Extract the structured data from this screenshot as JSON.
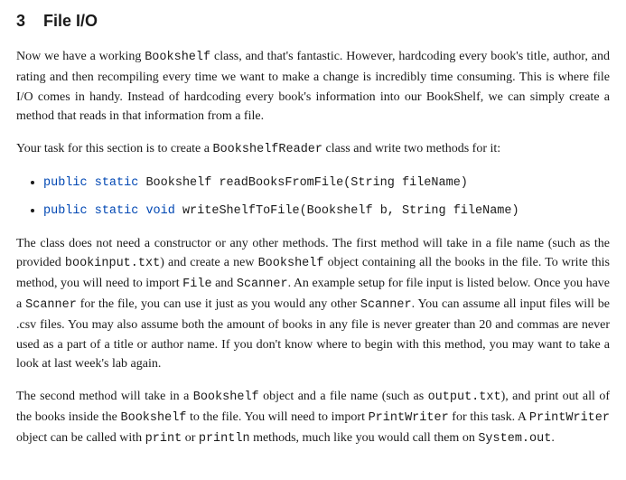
{
  "heading": {
    "number": "3",
    "title": "File I/O"
  },
  "para1": {
    "t1": "Now we have a working ",
    "c1": "Bookshelf",
    "t2": " class, and that's fantastic. However, hardcoding every book's title, author, and rating and then recompiling every time we want to make a change is incredibly time consuming. This is where file I/O comes in handy. Instead of hardcoding every book's information into our BookShelf, we can simply create a method that reads in that information from a file."
  },
  "para2": {
    "t1": "Your task for this section is to create a ",
    "c1": "BookshelfReader",
    "t2": " class and write two methods for it:"
  },
  "sig1": {
    "kw1": "public",
    "kw2": "static",
    "rest": "Bookshelf readBooksFromFile(String fileName)"
  },
  "sig2": {
    "kw1": "public",
    "kw2": "static",
    "kw3": "void",
    "rest": "writeShelfToFile(Bookshelf b, String fileName)"
  },
  "para3": {
    "t1": "The class does not need a constructor or any other methods. The first method will take in a file name (such as the provided ",
    "c1": "bookinput.txt",
    "t2": ") and create a new ",
    "c2": "Bookshelf",
    "t3": " object containing all the books in the file. To write this method, you will need to import ",
    "c3": "File",
    "t4": " and ",
    "c4": "Scanner",
    "t5": ". An example setup for file input is listed below. Once you have a ",
    "c5": "Scanner",
    "t6": " for the file, you can use it just as you would any other ",
    "c6": "Scanner",
    "t7": ". You can assume all input files will be .csv files. You may also assume both the amount of books in any file is never greater than 20 and commas are never used as a part of a title or author name. If you don't know where to begin with this method, you may want to take a look at last week's lab again."
  },
  "para4": {
    "t1": "The second method will take in a ",
    "c1": "Bookshelf",
    "t2": " object and a file name (such as ",
    "c2": "output.txt",
    "t3": "), and print out all of the books inside the ",
    "c3": "Bookshelf",
    "t4": " to the file. You will need to import ",
    "c4": "PrintWriter",
    "t5": " for this task. A ",
    "c5": "PrintWriter",
    "t6": " object can be called with ",
    "c6": "print",
    "t7": " or ",
    "c7": "println",
    "t8": " methods, much like you would call them on ",
    "c8": "System.out",
    "t9": "."
  }
}
